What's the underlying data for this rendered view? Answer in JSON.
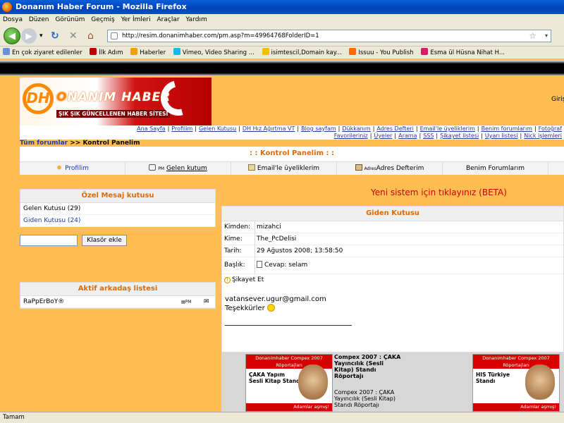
{
  "window": {
    "title": "Donanım Haber Forum - Mozilla Firefox"
  },
  "menu": [
    "Dosya",
    "Düzen",
    "Görünüm",
    "Geçmiş",
    "Yer İmleri",
    "Araçlar",
    "Yardım"
  ],
  "url": "http://resim.donanimhaber.com/pm.asp?m=49964768FolderID=1",
  "bookmarks": [
    {
      "label": "En çok ziyaret edilenler",
      "color": "#6b8fd6"
    },
    {
      "label": "İlk Adım",
      "color": "#c00000"
    },
    {
      "label": "Haberler",
      "color": "#f0a000"
    },
    {
      "label": "Vimeo, Video Sharing ...",
      "color": "#1ab7ea"
    },
    {
      "label": "isimtescil,Domain kay...",
      "color": "#f3c000"
    },
    {
      "label": "Issuu - You Publish",
      "color": "#ff6a00"
    },
    {
      "label": "Esma ül Hüsna Nihat H...",
      "color": "#d0206a"
    }
  ],
  "status": "Tamam",
  "header": {
    "logo_letters": "DH",
    "logo_name": "ONANIM HABER",
    "tagline": "ŞIK ŞIK GÜNCELLENEN HABER SİTESİ",
    "login": "Giriş"
  },
  "topnav": [
    "Ana Sayfa",
    "Profilim",
    "Gelen Kutusu",
    "DH Hız Ağırtma VT",
    "Blog sayfam",
    "Dükkanım",
    "Adres Defteri",
    "Email'le üyeliklerim",
    "Benim forumlarım",
    "Fotoğraf",
    "Favorileriniz",
    "Üyeler",
    "Arama",
    "SSS",
    "Şikayet listesi",
    "Uyarı listesi",
    "Nick işlemleri"
  ],
  "breadcrumb": {
    "link": "Tüm forumlar",
    "sep": " >> ",
    "current": "Kontrol Panelim"
  },
  "control_panel": {
    "title": ": : Kontrol Panelim : :",
    "tabs": [
      {
        "label": "Profilim",
        "icon": "user-icon"
      },
      {
        "label": "Gelen kutum",
        "prefix": "PM",
        "icon": "pm-icon"
      },
      {
        "label": "Email'le üyeliklerim",
        "icon": "mail-icon"
      },
      {
        "label": "Adres Defterim",
        "prefix": "Adres",
        "icon": "addressbook-icon"
      },
      {
        "label": "Benim Forumlarım",
        "icon": ""
      }
    ]
  },
  "pm_box": {
    "title": "Özel Mesaj kutusu",
    "items": [
      "Gelen Kutusu (29)",
      "Giden Kutusu (24)"
    ]
  },
  "folder_button": "Klasör ekle",
  "friends": {
    "title": "Aktif arkadaş listesi",
    "items": [
      {
        "name": "RaPpErBoY®",
        "pm": "PM"
      }
    ]
  },
  "beta_link": "Yeni sistem için tıklayınız (BETA)",
  "message": {
    "folder_title": "Giden Kutusu",
    "from_label": "Kimden:",
    "from": "mizahci",
    "to_label": "Kime:",
    "to": "The_PcDelisi",
    "date_label": "Tarih:",
    "date": "29 Ağustos 2008; 13:58:50",
    "subject_label": "Başlık:",
    "subject": "Cevap: selam",
    "report": "Şikayet Et",
    "body_line1": "vatansever.ugur@gmail.com",
    "body_line2": "Teşekkürler"
  },
  "ads": [
    {
      "header": "Donanimhaber Compex 2007 Röportajları",
      "title": "ÇAKA Yapım",
      "sub": "Sesli Kitap Standı",
      "footer": "Adamlar aşmış!"
    },
    {
      "header": "Donanimhaber Compex 2007 Röportajları",
      "title": "HIS Türkiye",
      "sub": "Standı",
      "footer": "Adamlar aşmış!"
    }
  ],
  "ad_caption": {
    "bold": "Compex 2007 : ÇAKA Yayıncılık (Sesli Kitap) Standı Röportajı",
    "normal": "Compex 2007 : ÇAKA Yayıncılık (Sesli Kitap) Standı Röportajı"
  }
}
